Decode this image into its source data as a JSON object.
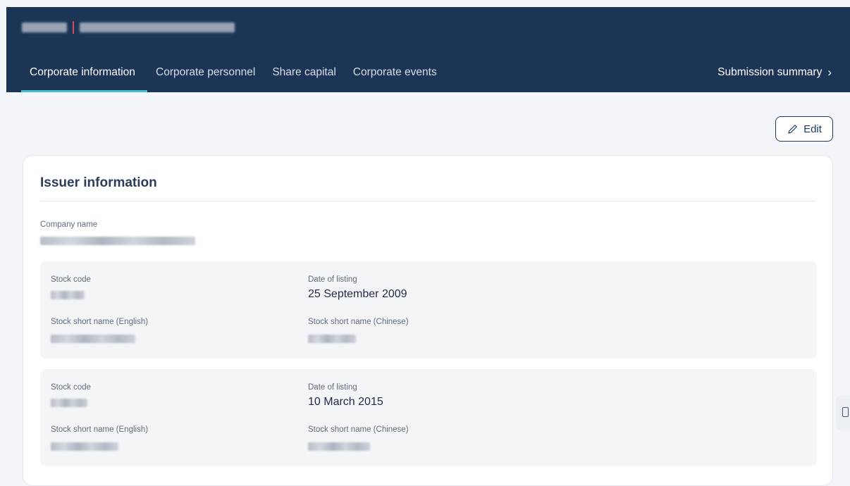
{
  "header": {
    "tabs": [
      {
        "label": "Corporate information",
        "active": true
      },
      {
        "label": "Corporate personnel",
        "active": false
      },
      {
        "label": "Share capital",
        "active": false
      },
      {
        "label": "Corporate events",
        "active": false
      }
    ],
    "summary_label": "Submission summary",
    "summary_icon": "chevron-right-icon"
  },
  "toolbar": {
    "edit_label": "Edit",
    "edit_icon": "pencil-icon"
  },
  "issuer": {
    "title": "Issuer information",
    "company_name_label": "Company name",
    "listings": [
      {
        "stock_code_label": "Stock code",
        "date_label": "Date of listing",
        "date_value": "25 September 2009",
        "short_en_label": "Stock short name (English)",
        "short_cn_label": "Stock short name (Chinese)"
      },
      {
        "stock_code_label": "Stock code",
        "date_label": "Date of listing",
        "date_value": "10 March 2015",
        "short_en_label": "Stock short name (English)",
        "short_cn_label": "Stock short name (Chinese)"
      }
    ]
  },
  "colors": {
    "header_bg": "#1c3557",
    "tab_active_underline": "#46c0d6",
    "title_separator": "#e0455f"
  }
}
